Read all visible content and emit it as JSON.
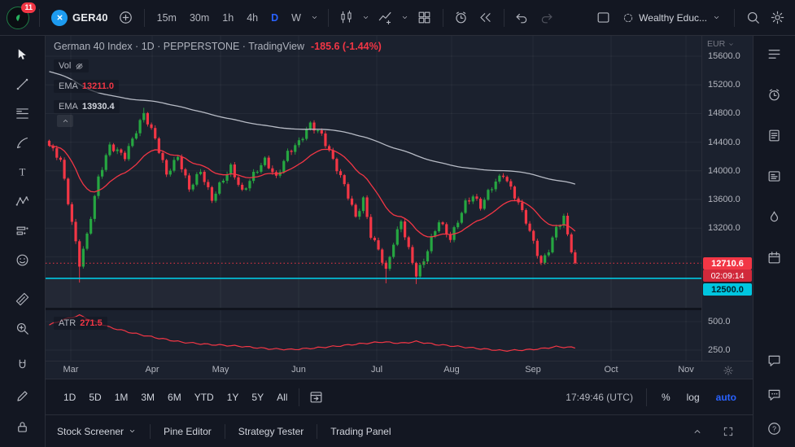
{
  "colors": {
    "up": "#26a641",
    "down": "#f23645",
    "accent": "#2962ff",
    "cyan": "#00c6e0",
    "ema_fast": "#f23645",
    "ema_slow": "#b8bcc6",
    "atr_line": "#f23645",
    "badge_price": "#f23645",
    "badge_countdown": "#d1293b"
  },
  "topbar": {
    "notifications_badge": "11",
    "symbol": "GER40",
    "timeframes": [
      "15m",
      "30m",
      "1h",
      "4h",
      "D",
      "W"
    ],
    "active_timeframe": "D",
    "account_name": "Wealthy Educ..."
  },
  "left_toolbar_icons": [
    "cursor",
    "trend-line",
    "fib-retracement",
    "brush",
    "text",
    "xabcd-pattern",
    "forecast",
    "emoji",
    "ruler",
    "zoom",
    "magnet",
    "edit",
    "lock"
  ],
  "right_sidebar_icons": [
    "watchlist",
    "alerts",
    "news",
    "data-window",
    "hotlists",
    "calendar",
    "chat",
    "ideas",
    "help"
  ],
  "legend": {
    "title": "German 40 Index · 1D · PEPPERSTONE · TradingView",
    "change": "-185.6 (-1.44%)",
    "volume_label": "Vol",
    "indicators": [
      {
        "label": "EMA",
        "value": "13211.0"
      },
      {
        "label": "EMA",
        "value": "13930.4"
      }
    ]
  },
  "price_axis": {
    "currency": "EUR",
    "ticks": [
      "15600.0",
      "15200.0",
      "14800.0",
      "14400.0",
      "14000.0",
      "13600.0",
      "13200.0"
    ],
    "last_price": "12710.6",
    "countdown": "02:09:14",
    "level_price": "12500.0"
  },
  "atr_pane": {
    "label": "ATR",
    "value": "271.5",
    "ticks": [
      "500.0",
      "250.0"
    ]
  },
  "time_axis": {
    "months": [
      "Mar",
      "Apr",
      "May",
      "Jun",
      "Jul",
      "Aug",
      "Sep",
      "Oct",
      "Nov"
    ]
  },
  "range_toolbar": {
    "ranges": [
      "1D",
      "5D",
      "1M",
      "3M",
      "6M",
      "YTD",
      "1Y",
      "5Y",
      "All"
    ],
    "clock": "17:49:46 (UTC)",
    "percent_label": "%",
    "log_label": "log",
    "auto_label": "auto"
  },
  "bottom_tabs": {
    "tabs": [
      "Stock Screener",
      "Pine Editor",
      "Strategy Tester",
      "Trading Panel"
    ]
  },
  "chart_data": {
    "type": "candlestick",
    "title": "German 40 Index, 1D, PEPPERSTONE",
    "interval": "1D",
    "currency": "EUR",
    "change": -185.6,
    "change_pct": -1.44,
    "last_price": 12710.6,
    "level_line": 12500,
    "y_ticks": [
      15600,
      15200,
      14800,
      14400,
      14000,
      13600,
      13200
    ],
    "hidden_grid": [
      12800
    ],
    "x_months": [
      "Mar",
      "Apr",
      "May",
      "Jun",
      "Jul",
      "Aug",
      "Sep",
      "Oct",
      "Nov"
    ],
    "closes": [
      14350,
      14283,
      14217,
      14150,
      13860,
      13570,
      13280,
      12990,
      12700,
      12900,
      13100,
      13367,
      13633,
      13900,
      14050,
      14200,
      14350,
      14313,
      14275,
      14238,
      14200,
      14320,
      14440,
      14560,
      14680,
      14800,
      14683,
      14567,
      14450,
      14283,
      14117,
      13950,
      14033,
      14117,
      14200,
      14050,
      13900,
      13750,
      13833,
      13917,
      14000,
      13867,
      13733,
      13600,
      13700,
      13800,
      13883,
      13967,
      14050,
      13933,
      13817,
      13700,
      13783,
      13867,
      13950,
      14017,
      14083,
      14150,
      14067,
      13983,
      13900,
      14017,
      14133,
      14250,
      14300,
      14350,
      14400,
      14483,
      14567,
      14650,
      14600,
      14550,
      14500,
      14383,
      14267,
      14150,
      14033,
      13917,
      13800,
      13650,
      13500,
      13350,
      13475,
      13600,
      13350,
      13100,
      13000,
      12900,
      12750,
      12600,
      12800,
      13000,
      13150,
      13300,
      13100,
      12900,
      12725,
      12550,
      12650,
      12750,
      12900,
      13050,
      13175,
      13300,
      13217,
      13133,
      13050,
      13175,
      13300,
      13425,
      13550,
      13600,
      13650,
      13575,
      13500,
      13600,
      13700,
      13775,
      13850,
      13900,
      13950,
      13850,
      13750,
      13650,
      13550,
      13425,
      13300,
      13150,
      13000,
      12850,
      12700,
      12800,
      12900,
      13050,
      13200,
      13275,
      13350,
      13100,
      12900,
      12710.6
    ],
    "wick_overrides": {
      "8": {
        "low": 12440
      },
      "25": {
        "high": 14880
      },
      "89": {
        "low": 12430
      },
      "97": {
        "low": 12420
      }
    },
    "ema_fast": {
      "label": "EMA",
      "period": 21,
      "seed": 14350,
      "last": 13211.0
    },
    "ema_slow": {
      "label": "EMA",
      "period": 150,
      "seed": 15400,
      "last": 13930.4
    },
    "atr": {
      "label": "ATR",
      "last": 271.5,
      "y_ticks": [
        500,
        250
      ],
      "waypoints": [
        [
          0,
          470
        ],
        [
          4,
          520
        ],
        [
          8,
          555
        ],
        [
          12,
          500
        ],
        [
          16,
          450
        ],
        [
          22,
          400
        ],
        [
          28,
          360
        ],
        [
          35,
          320
        ],
        [
          42,
          300
        ],
        [
          50,
          285
        ],
        [
          58,
          262
        ],
        [
          64,
          255
        ],
        [
          70,
          268
        ],
        [
          76,
          285
        ],
        [
          82,
          305
        ],
        [
          88,
          322
        ],
        [
          93,
          310
        ],
        [
          97,
          325
        ],
        [
          102,
          300
        ],
        [
          108,
          282
        ],
        [
          114,
          262
        ],
        [
          120,
          245
        ],
        [
          126,
          252
        ],
        [
          130,
          262
        ],
        [
          134,
          280
        ],
        [
          139,
          271.5
        ]
      ]
    }
  }
}
